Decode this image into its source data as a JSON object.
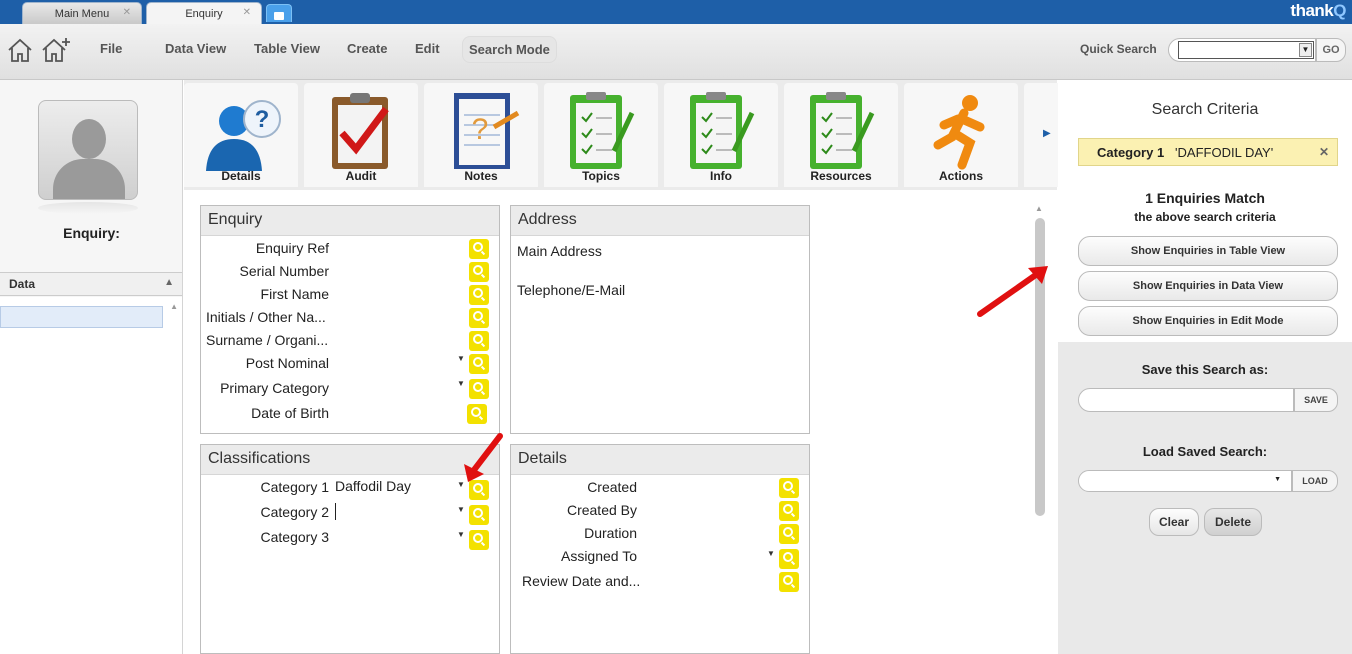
{
  "tabs": {
    "main_menu": "Main Menu",
    "enquiry": "Enquiry",
    "close": "✕"
  },
  "brand": {
    "name": "thank",
    "suffix": "Q"
  },
  "toolbar": {
    "menu": [
      "File",
      "Data View",
      "Table View",
      "Create",
      "Edit",
      "Search Mode"
    ],
    "quick_search_label": "Quick Search",
    "quick_search_value": "",
    "go_label": "GO"
  },
  "left": {
    "enquiry_label": "Enquiry:",
    "data_header": "Data"
  },
  "icons": [
    "Details",
    "Audit",
    "Notes",
    "Topics",
    "Info",
    "Resources",
    "Actions"
  ],
  "enquiry_panel": {
    "title": "Enquiry",
    "fields": [
      "Enquiry Ref",
      "Serial Number",
      "First Name",
      "Initials / Other Na...",
      "Surname / Organi...",
      "Post Nominal",
      "Primary  Category",
      "Date of Birth"
    ]
  },
  "address_panel": {
    "title": "Address",
    "fields": [
      "Main Address",
      "Telephone/E-Mail"
    ]
  },
  "classifications_panel": {
    "title": "Classifications",
    "fields": [
      {
        "label": "Category 1",
        "value": "Daffodil Day"
      },
      {
        "label": "Category 2",
        "value": ""
      },
      {
        "label": "Category 3",
        "value": ""
      }
    ]
  },
  "details_panel": {
    "title": "Details",
    "fields": [
      "Created",
      "Created By",
      "Duration",
      "Assigned To",
      "Review Date and..."
    ]
  },
  "search": {
    "title": "Search Criteria",
    "criteria_label": "Category 1",
    "criteria_value": "'DAFFODIL DAY'",
    "criteria_remove": "✕",
    "match_count": "1 Enquiries Match",
    "match_sub": "the above search criteria",
    "btn_table": "Show Enquiries in Table View",
    "btn_data": "Show Enquiries in Data View",
    "btn_edit": "Show Enquiries in Edit Mode",
    "save_label": "Save this Search as:",
    "save_value": "",
    "save_btn": "SAVE",
    "load_label": "Load Saved Search:",
    "load_btn": "LOAD",
    "clear_btn": "Clear",
    "delete_btn": "Delete"
  },
  "colors": {
    "accent": "#1e5fa8",
    "criteria_bg": "#fbf1b2",
    "search_icon": "#f3e100",
    "arrow": "#e01010"
  }
}
